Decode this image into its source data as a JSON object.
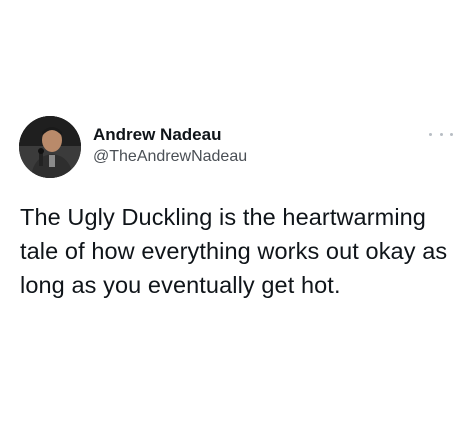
{
  "tweet": {
    "author": {
      "display_name": "Andrew Nadeau",
      "handle": "@TheAndrewNadeau",
      "avatar_icon": "profile-photo"
    },
    "more_icon": "more-options-icon",
    "text": "The Ugly Duckling is the heartwarming tale of how everything works out okay as long as you eventually get hot."
  },
  "colors": {
    "background": "#ffffff",
    "text": "#0f1419",
    "secondary_text": "#4a4f55",
    "icon_muted": "#b8bec4"
  }
}
